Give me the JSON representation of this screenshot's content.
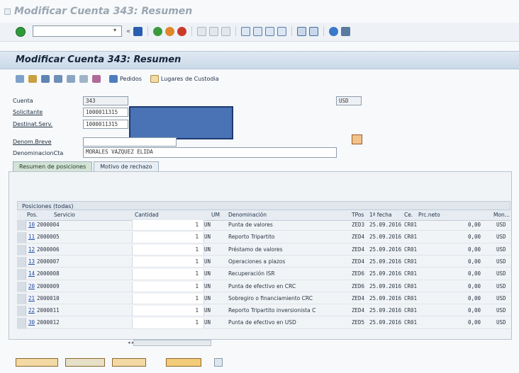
{
  "window": {
    "title": "Modificar Cuenta 343: Resumen"
  },
  "app": {
    "title": "Modificar Cuenta 343: Resumen"
  },
  "app_toolbar": {
    "pedidos_label": "Pedidos",
    "lugares_label": "Lugares de Custodia"
  },
  "header": {
    "cuenta_label": "Cuenta",
    "cuenta_value": "343",
    "currency_value": "USD",
    "solicitante_label": "Solicitante",
    "solicitante_value": "1000011315",
    "destinat_label": "Destinat.Serv.",
    "destinat_value": "1000011315",
    "denom_label": "Denom.Breve",
    "denom_value": "",
    "denomcta_label": "DenominacionCta",
    "denomcta_value": "MORALES VAZQUEZ ELIDA"
  },
  "tabs": [
    "Resumen de posiciones",
    "Motivo de rechazo"
  ],
  "grid": {
    "title": "Posiciones (todas)",
    "columns": [
      "Pos.",
      "Servicio",
      "Cantidad",
      "UM",
      "Denominación",
      "TPos",
      "1ª fecha",
      "Ce.",
      "Prc.neto",
      "Mon..."
    ],
    "rows": [
      {
        "pos": "10",
        "serv": "2000004",
        "cant": "1",
        "um": "UN",
        "den": "Punta de valores",
        "tpos": "ZED3",
        "fecha": "25.09.2016",
        "ce": "CR01",
        "prc": "0,00",
        "mon": "USD"
      },
      {
        "pos": "11",
        "serv": "2000005",
        "cant": "1",
        "um": "UN",
        "den": "Reporto Tripartito",
        "tpos": "ZED4",
        "fecha": "25.09.2016",
        "ce": "CR01",
        "prc": "0,00",
        "mon": "USD"
      },
      {
        "pos": "12",
        "serv": "2000006",
        "cant": "1",
        "um": "UN",
        "den": "Préstamo de valores",
        "tpos": "ZED4",
        "fecha": "25.09.2016",
        "ce": "CR01",
        "prc": "0,00",
        "mon": "USD"
      },
      {
        "pos": "13",
        "serv": "2000007",
        "cant": "1",
        "um": "UN",
        "den": "Operaciones a plazos",
        "tpos": "ZED4",
        "fecha": "25.09.2016",
        "ce": "CR01",
        "prc": "0,00",
        "mon": "USD"
      },
      {
        "pos": "14",
        "serv": "2000008",
        "cant": "1",
        "um": "UN",
        "den": "Recuperación ISR",
        "tpos": "ZED6",
        "fecha": "25.09.2016",
        "ce": "CR01",
        "prc": "0,00",
        "mon": "USD"
      },
      {
        "pos": "20",
        "serv": "2000009",
        "cant": "1",
        "um": "UN",
        "den": "Punta de efectivo en CRC",
        "tpos": "ZED6",
        "fecha": "25.09.2016",
        "ce": "CR01",
        "prc": "0,00",
        "mon": "USD"
      },
      {
        "pos": "21",
        "serv": "2000010",
        "cant": "1",
        "um": "UN",
        "den": "Sobregiro o financiamiento CRC",
        "tpos": "ZED4",
        "fecha": "25.09.2016",
        "ce": "CR01",
        "prc": "0,00",
        "mon": "USD"
      },
      {
        "pos": "22",
        "serv": "2000011",
        "cant": "1",
        "um": "UN",
        "den": "Reporto Tripartito inversionista C",
        "tpos": "ZED4",
        "fecha": "25.09.2016",
        "ce": "CR01",
        "prc": "0,00",
        "mon": "USD"
      },
      {
        "pos": "30",
        "serv": "2000012",
        "cant": "1",
        "um": "UN",
        "den": "Punta de efectivo en USD",
        "tpos": "ZED5",
        "fecha": "25.09.2016",
        "ce": "CR01",
        "prc": "0,00",
        "mon": "USD"
      }
    ]
  }
}
